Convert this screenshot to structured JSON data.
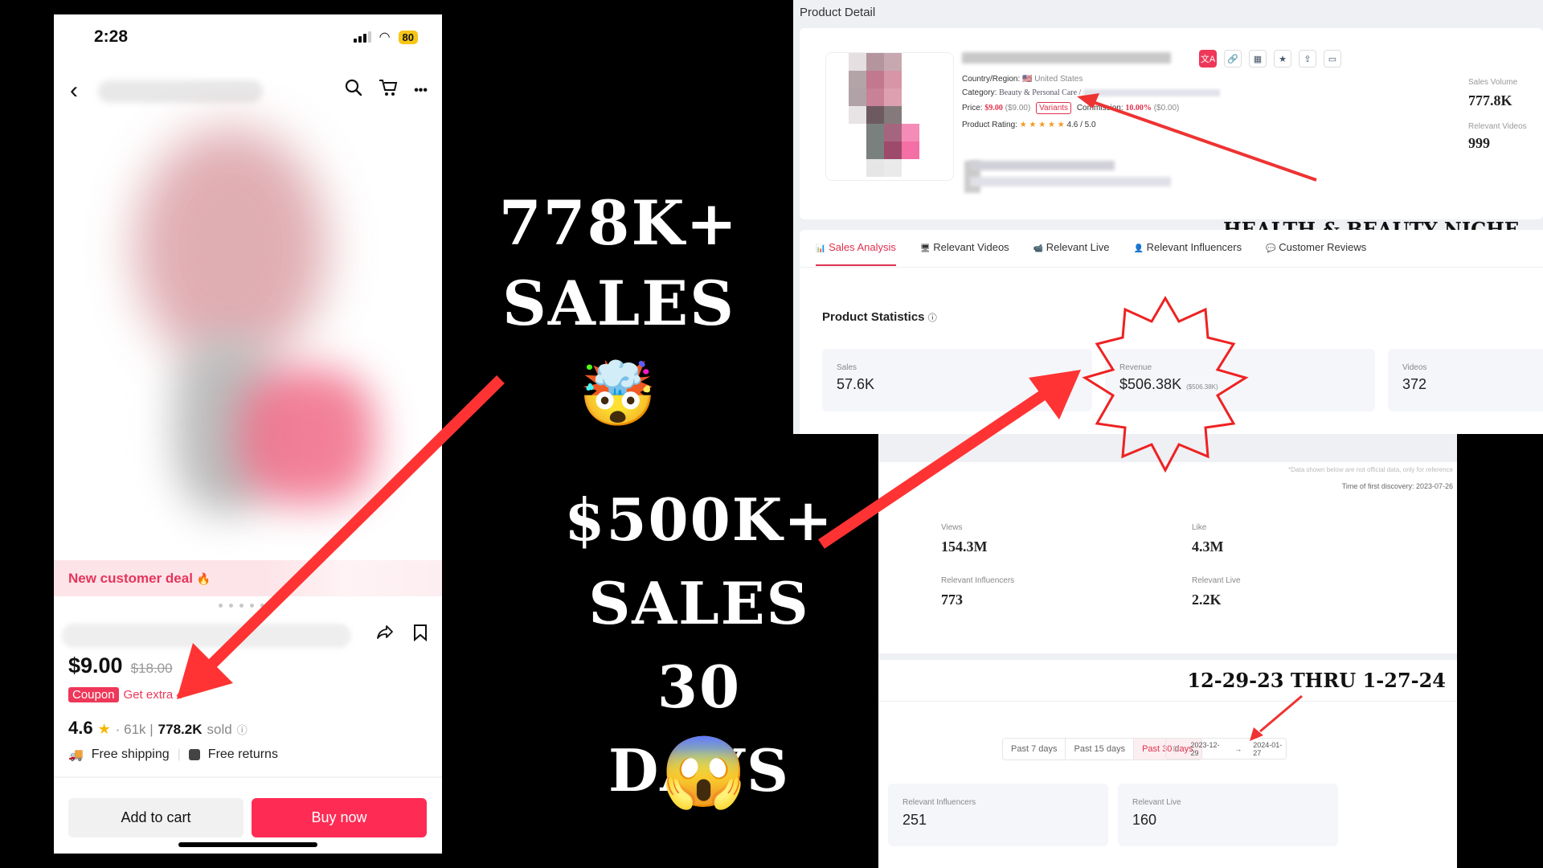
{
  "phone": {
    "status": {
      "time": "2:28",
      "battery": "80"
    },
    "nav": {
      "back_icon": "‹",
      "search_icon": "⌕",
      "cart_icon": "🛒",
      "more_icon": "•••"
    },
    "deal_banner": {
      "label": "New customer deal",
      "fire_icon": "🔥"
    },
    "price": {
      "current": "$9.00",
      "original": "$18.00"
    },
    "coupon": {
      "badge": "Coupon",
      "text": "Get extra 4"
    },
    "rating": {
      "value": "4.6",
      "reviews": "· 61k |",
      "sold_count": "778.2K",
      "sold_label": "sold",
      "info_icon": "ⓘ"
    },
    "shipping": {
      "free_shipping": "Free shipping",
      "free_returns": "Free returns"
    },
    "actions": {
      "add_to_cart": "Add to cart",
      "buy_now": "Buy now"
    }
  },
  "captions": {
    "headline1_line1": "778K+",
    "headline1_line2": "SALES",
    "emoji1": "🤯",
    "headline2_line1": "$500K+",
    "headline2_line2": "SALES",
    "headline2_line3": "30 DAYS",
    "emoji2": "😱",
    "niche": "HEALTH & BEAUTY NICHE",
    "date_range": "12-29-23 THRU 1-27-24"
  },
  "product_detail": {
    "title": "Product Detail",
    "country_label": "Country/Region:",
    "country_flag": "🇺🇸",
    "country_value": "United States",
    "category_label": "Category:",
    "category_value": "Beauty & Personal Care /",
    "price_label": "Price:",
    "price_value": "$9.00",
    "price_sub": "($9.00)",
    "variants_label": "Variants",
    "commission_label": "Commission:",
    "commission_value": "10.00%",
    "commission_sub": "($0.00)",
    "rating_label": "Product Rating:",
    "rating_stars": "★ ★ ★ ★ ★",
    "rating_value": "4.6 / 5.0",
    "sales_volume_label": "Sales Volume",
    "sales_volume_value": "777.8K",
    "relevant_videos_label": "Relevant Videos",
    "relevant_videos_value": "999",
    "action_icons": [
      "translate-icon",
      "link-icon",
      "qr-code-icon",
      "star-icon",
      "upload-icon",
      "screen-icon"
    ]
  },
  "tabs": [
    {
      "label": "Sales Analysis",
      "icon": "📊",
      "active": true
    },
    {
      "label": "Relevant Videos",
      "icon": "🖥"
    },
    {
      "label": "Relevant Live",
      "icon": "📹"
    },
    {
      "label": "Relevant Influencers",
      "icon": "👤"
    },
    {
      "label": "Customer Reviews",
      "icon": "💬"
    }
  ],
  "product_statistics": {
    "title": "Product Statistics",
    "help_icon": "ⓘ",
    "cards": [
      {
        "label": "Sales",
        "value": "57.6K"
      },
      {
        "label": "Revenue",
        "value": "$506.38K",
        "sub": "($506.38K)"
      },
      {
        "label": "Videos",
        "value": "372"
      }
    ]
  },
  "overview": {
    "disclaimer": "*Data shown below are not official data, only for reference",
    "first_discovery": "Time of first discovery: 2023-07-26",
    "stats": [
      {
        "label": "Views",
        "value": "154.3M"
      },
      {
        "label": "Like",
        "value": "4.3M"
      },
      {
        "label": "Relevant Influencers",
        "value": "773"
      },
      {
        "label": "Relevant Live",
        "value": "2.2K"
      }
    ]
  },
  "range": {
    "options": [
      "Past 7 days",
      "Past 15 days",
      "Past 30 days"
    ],
    "selected": "Past 30 days",
    "start_date": "2023-12-29",
    "arrow": "→",
    "end_date": "2024-01-27",
    "cards": [
      {
        "label": "Relevant Influencers",
        "value": "251"
      },
      {
        "label": "Relevant Live",
        "value": "160"
      }
    ]
  }
}
